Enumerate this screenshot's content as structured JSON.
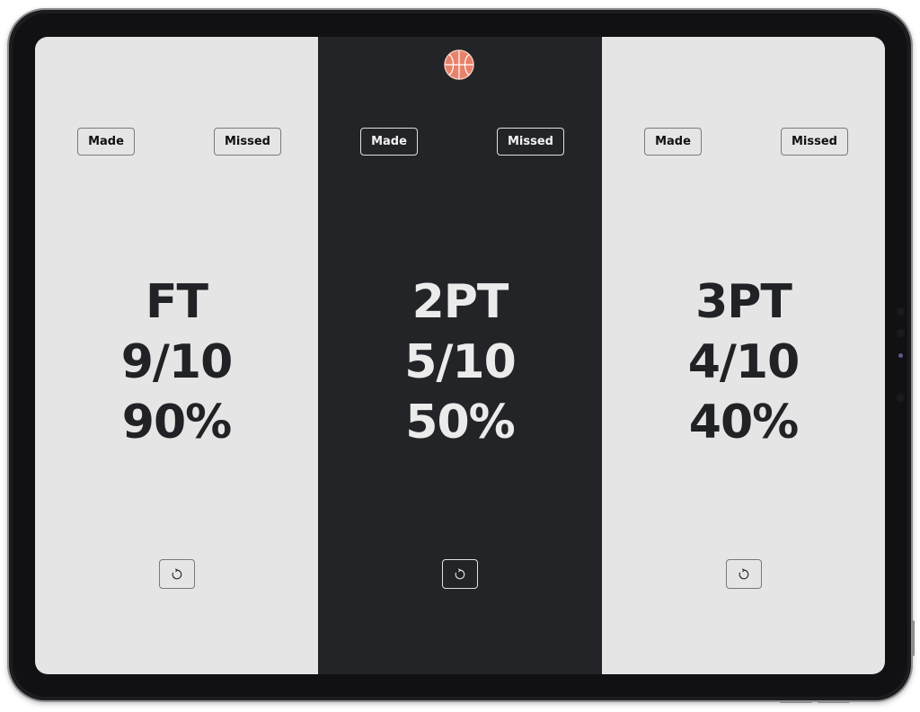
{
  "app": {
    "logo_icon": "basketball-icon",
    "reset_icon": "reset-icon",
    "colors": {
      "light_panel": "#e5e5e5",
      "dark_panel": "#222427",
      "dark_text": "#212226",
      "light_text": "#ebebeb",
      "logo_orange": "#e8826a"
    }
  },
  "panels": [
    {
      "made_label": "Made",
      "missed_label": "Missed",
      "category": "FT",
      "record": "9/10",
      "percent": "90%"
    },
    {
      "made_label": "Made",
      "missed_label": "Missed",
      "category": "2PT",
      "record": "5/10",
      "percent": "50%"
    },
    {
      "made_label": "Made",
      "missed_label": "Missed",
      "category": "3PT",
      "record": "4/10",
      "percent": "40%"
    }
  ]
}
